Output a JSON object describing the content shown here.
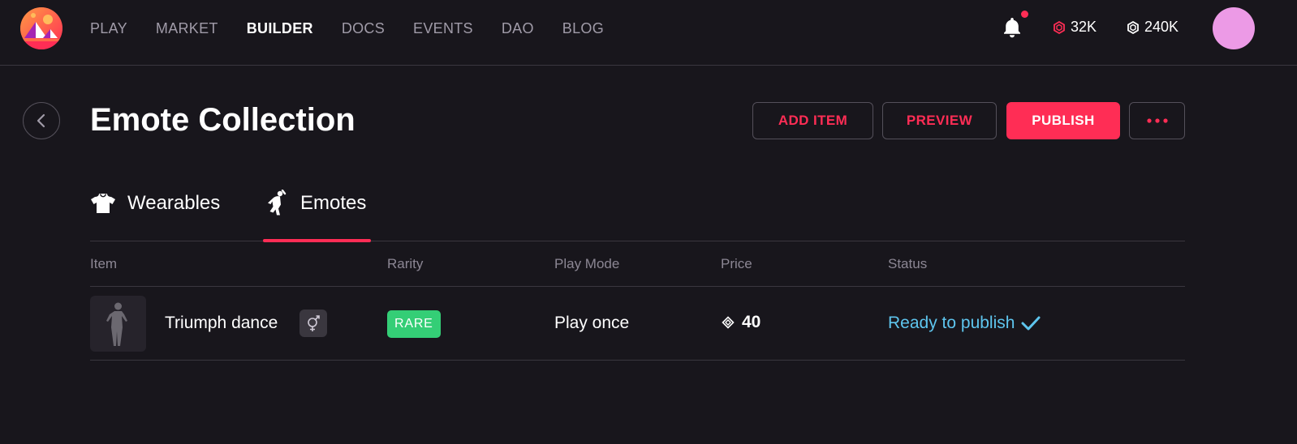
{
  "nav": {
    "items": [
      {
        "label": "PLAY",
        "active": false
      },
      {
        "label": "MARKET",
        "active": false
      },
      {
        "label": "BUILDER",
        "active": true
      },
      {
        "label": "DOCS",
        "active": false
      },
      {
        "label": "EVENTS",
        "active": false
      },
      {
        "label": "DAO",
        "active": false
      },
      {
        "label": "BLOG",
        "active": false
      }
    ],
    "notification_icon": "bell-icon",
    "has_notification": true,
    "balances": [
      {
        "currency_icon": "mana-icon",
        "amount": "32K",
        "color": "#ff2d55"
      },
      {
        "currency_icon": "polygon-mana-icon",
        "amount": "240K",
        "color": "#ffffff"
      }
    ],
    "avatar_color": "#ec9ae6"
  },
  "page": {
    "title": "Emote Collection",
    "back_icon": "chevron-left-icon"
  },
  "actions": {
    "add_item": "ADD ITEM",
    "preview": "PREVIEW",
    "publish": "PUBLISH",
    "more_icon": "ellipsis-icon"
  },
  "tabs": [
    {
      "label": "Wearables",
      "icon": "shirt-icon",
      "active": false
    },
    {
      "label": "Emotes",
      "icon": "dance-icon",
      "active": true
    }
  ],
  "table": {
    "columns": [
      "Item",
      "Rarity",
      "Play Mode",
      "Price",
      "Status"
    ],
    "rows": [
      {
        "name": "Triumph dance",
        "gender_icon": "unisex-icon",
        "rarity": "RARE",
        "play_mode": "Play once",
        "price": "40",
        "price_icon": "mana-diamond-icon",
        "status": "Ready to publish",
        "status_icon": "checkmark-icon"
      }
    ]
  },
  "colors": {
    "accent": "#ff2d55",
    "background": "#18161c",
    "status_ready": "#5ec5ee",
    "rarity_rare": "#34ce76"
  }
}
